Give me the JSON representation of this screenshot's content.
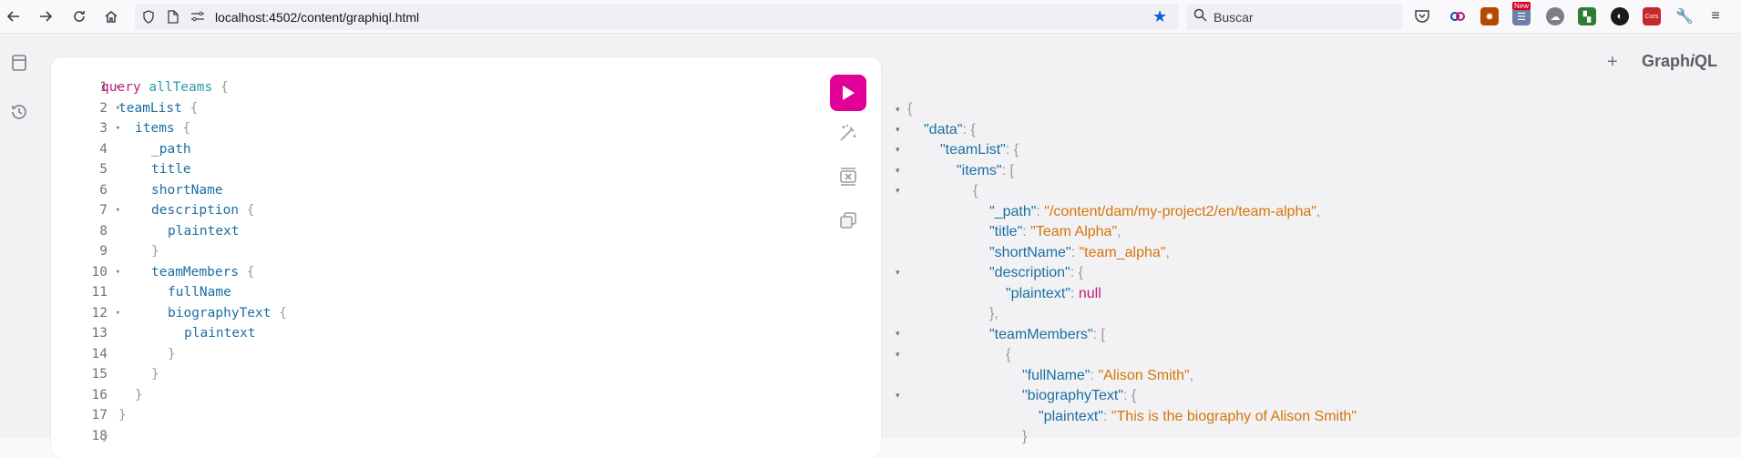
{
  "browser": {
    "url": "localhost:4502/content/graphiql.html",
    "search_placeholder": "Buscar",
    "nav_icons": [
      "back-arrow-icon",
      "forward-arrow-icon",
      "reload-icon",
      "home-icon"
    ],
    "extension_badge": "New",
    "extension_cors": "Cors"
  },
  "graphiql": {
    "logo_prefix": "Graph",
    "logo_i": "i",
    "logo_suffix": "QL",
    "plus_label": "+",
    "query_lines": [
      {
        "num": "1",
        "fold": true
      },
      {
        "num": "2",
        "fold": true
      },
      {
        "num": "3",
        "fold": true
      },
      {
        "num": "4",
        "fold": false
      },
      {
        "num": "5",
        "fold": false
      },
      {
        "num": "6",
        "fold": false
      },
      {
        "num": "7",
        "fold": true
      },
      {
        "num": "8",
        "fold": false
      },
      {
        "num": "9",
        "fold": false
      },
      {
        "num": "10",
        "fold": true
      },
      {
        "num": "11",
        "fold": false
      },
      {
        "num": "12",
        "fold": true
      },
      {
        "num": "13",
        "fold": false
      },
      {
        "num": "14",
        "fold": false
      },
      {
        "num": "15",
        "fold": false
      },
      {
        "num": "16",
        "fold": false
      },
      {
        "num": "17",
        "fold": false
      },
      {
        "num": "18",
        "fold": false
      }
    ],
    "query_tokens": {
      "l1_kw": "query",
      "l1_name": "allTeams",
      "open": "{",
      "close": "}",
      "l2": "teamList",
      "l3": "items",
      "l4": "_path",
      "l5": "title",
      "l6": "shortName",
      "l7": "description",
      "l8": "plaintext",
      "l10": "teamMembers",
      "l11": "fullName",
      "l12": "biographyText",
      "l13": "plaintext"
    },
    "result": {
      "k_data": "\"data\"",
      "k_teamList": "\"teamList\"",
      "k_items": "\"items\"",
      "k_path": "\"_path\"",
      "v_path": "\"/content/dam/my-project2/en/team-alpha\"",
      "k_title": "\"title\"",
      "v_title": "\"Team Alpha\"",
      "k_shortName": "\"shortName\"",
      "v_shortName": "\"team_alpha\"",
      "k_description": "\"description\"",
      "k_plaintext": "\"plaintext\"",
      "v_null": "null",
      "k_teamMembers": "\"teamMembers\"",
      "k_fullName": "\"fullName\"",
      "v_fullName": "\"Alison Smith\"",
      "k_biographyText": "\"biographyText\"",
      "v_bio": "\"This is the biography of Alison Smith\""
    }
  }
}
